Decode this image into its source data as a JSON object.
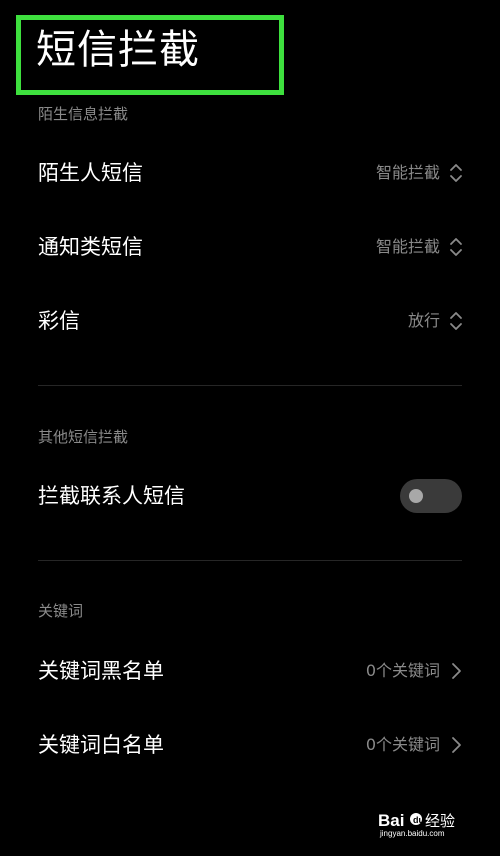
{
  "page_title": "短信拦截",
  "sections": [
    {
      "header": "陌生信息拦截",
      "rows": [
        {
          "label": "陌生人短信",
          "value": "智能拦截",
          "icon": "up-down-chevron-icon"
        },
        {
          "label": "通知类短信",
          "value": "智能拦截",
          "icon": "up-down-chevron-icon"
        },
        {
          "label": "彩信",
          "value": "放行",
          "icon": "up-down-chevron-icon"
        }
      ]
    },
    {
      "header": "其他短信拦截",
      "rows": [
        {
          "label": "拦截联系人短信",
          "toggle_on": false
        }
      ]
    },
    {
      "header": "关键词",
      "rows": [
        {
          "label": "关键词黑名单",
          "value": "0个关键词",
          "icon": "chevron-right-icon"
        },
        {
          "label": "关键词白名单",
          "value": "0个关键词",
          "icon": "chevron-right-icon"
        }
      ]
    }
  ],
  "watermark": {
    "brand": "Baidu经验",
    "url": "jingyan.baidu.com"
  },
  "colors": {
    "background": "#000000",
    "primary_text": "#ffffff",
    "secondary_text": "#8a8a8a",
    "highlight_box": "#3ee03e",
    "divider": "#262626",
    "toggle_track": "#3a3a3a",
    "toggle_knob": "#a8a8a8"
  }
}
